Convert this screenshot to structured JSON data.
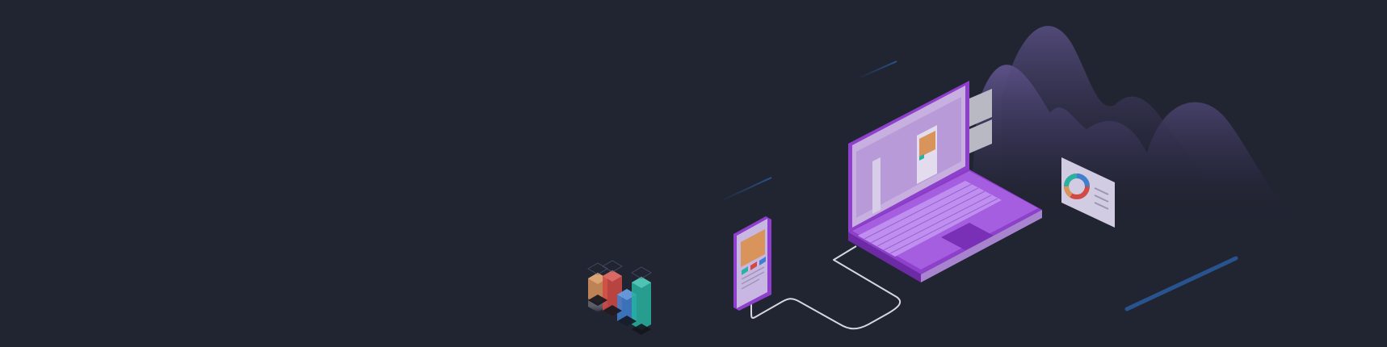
{
  "colors": {
    "background": "#212431",
    "laptop": "#9a4fd6",
    "laptop_dark": "#7b36b8",
    "screen": "#bfa6d9",
    "mountains": "#5a4d86",
    "cable": "#d6d6e0",
    "accent_blue": "#2a5fa8",
    "orange": "#d8945a",
    "teal": "#27b3a0",
    "red": "#d24a44",
    "blue": "#3f7fd0"
  },
  "icons": {
    "laptop": "laptop-icon",
    "phone": "smartphone-icon",
    "chart_card": "donut-chart-card-icon",
    "bars": "bar-chart-icon",
    "mountains": "mountain-waves-icon"
  }
}
